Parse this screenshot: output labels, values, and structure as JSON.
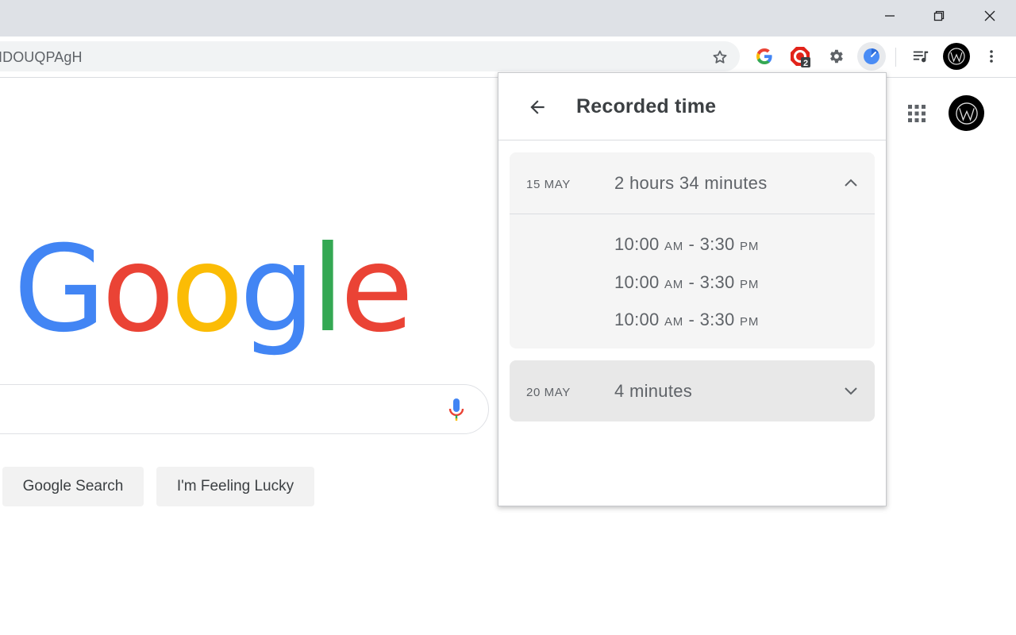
{
  "browser": {
    "address_text": "IDOUQPAgH",
    "extension_badge": "2"
  },
  "page": {
    "logo": {
      "letters": [
        "G",
        "o",
        "o",
        "g",
        "l",
        "e"
      ],
      "colors": [
        "#4285F4",
        "#EA4335",
        "#FBBC05",
        "#4285F4",
        "#34A853",
        "#EA4335"
      ]
    },
    "buttons": {
      "search": "Google Search",
      "lucky": "I'm Feeling Lucky"
    }
  },
  "popup": {
    "title": "Recorded time",
    "days": [
      {
        "date": "15 MAY",
        "total": "2 hours 34 minutes",
        "expanded": true,
        "ranges": [
          {
            "start": "10:00",
            "start_period": "AM",
            "end": "3:30",
            "end_period": "PM"
          },
          {
            "start": "10:00",
            "start_period": "AM",
            "end": "3:30",
            "end_period": "PM"
          },
          {
            "start": "10:00",
            "start_period": "AM",
            "end": "3:30",
            "end_period": "PM"
          }
        ]
      },
      {
        "date": "20 MAY",
        "total": "4 minutes",
        "expanded": false
      }
    ]
  },
  "icons": {
    "minimize": "minimize-icon",
    "restore": "restore-icon",
    "close": "close-icon",
    "bookmark": "star-icon",
    "google_ext": "google-icon",
    "adblock_ext": "adblock-icon",
    "settings_ext": "gear-icon",
    "timer_ext": "clock-icon",
    "media": "media-playlist-icon",
    "menu": "kebab-menu-icon",
    "apps": "apps-grid-icon",
    "mic": "microphone-icon",
    "back": "arrow-back-icon"
  },
  "colors": {
    "titlebar": "#dee1e6",
    "omnibox": "#f1f3f4",
    "card": "#f5f5f5",
    "card_collapsed": "#e8e8e8",
    "text_secondary": "#5f6368"
  }
}
